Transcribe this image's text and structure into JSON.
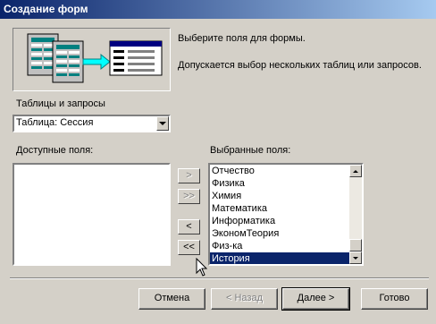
{
  "window": {
    "title": "Создание форм"
  },
  "intro": {
    "line1": "Выберите поля для формы.",
    "line2": "Допускается выбор нескольких таблиц или запросов."
  },
  "source": {
    "label": "Таблицы и запросы",
    "selected": "Таблица: Сессия"
  },
  "available": {
    "label": "Доступные поля:",
    "items": []
  },
  "selected_fields": {
    "label": "Выбранные поля:",
    "items": [
      "Отчество",
      "Физика",
      "Химия",
      "Математика",
      "Информатика",
      "ЭкономТеория",
      "Физ-ка",
      "История"
    ],
    "highlighted": "История"
  },
  "move_buttons": {
    "add_one": ">",
    "add_all": ">>",
    "remove_one": "<",
    "remove_all": "<<"
  },
  "footer": {
    "cancel": "Отмена",
    "back": "< Назад",
    "next": "Далее >",
    "finish": "Готово"
  },
  "colors": {
    "title_bar": "#0a246a",
    "dialog_bg": "#d4d0c8",
    "selection": "#0a246a",
    "illustration_arrow": "#00ffff"
  },
  "icons": [
    "form-wizard-illustration",
    "combo-arrow-icon",
    "scroll-up-icon",
    "scroll-down-icon",
    "mouse-cursor-icon"
  ]
}
